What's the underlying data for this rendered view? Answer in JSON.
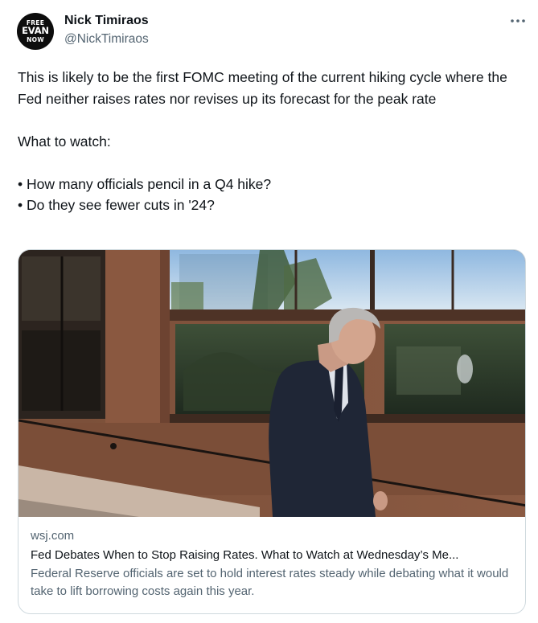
{
  "author": {
    "avatar_lines": [
      "FREE",
      "EVAN",
      "NOW"
    ],
    "display_name": "Nick Timiraos",
    "handle": "@NickTimiraos"
  },
  "more_icon": "more-horizontal-icon",
  "tweet": {
    "paragraph_1": "This is likely to be the first FOMC meeting of the current hiking cycle where the Fed neither raises rates nor revises up its forecast for the peak rate",
    "paragraph_2": "What to watch:",
    "bullet_1": "• How many officials pencil in a Q4 hike?",
    "bullet_2": "• Do they see fewer cuts in '24?"
  },
  "card": {
    "domain": "wsj.com",
    "title": "Fed Debates When to Stop Raising Rates. What to Watch at Wednesday’s Me...",
    "description": "Federal Reserve officials are set to hold interest rates steady while debating what it would take to lift borrowing costs again this year."
  },
  "colors": {
    "text_primary": "#0f1419",
    "text_secondary": "#536471",
    "card_border": "#cfd9de"
  }
}
